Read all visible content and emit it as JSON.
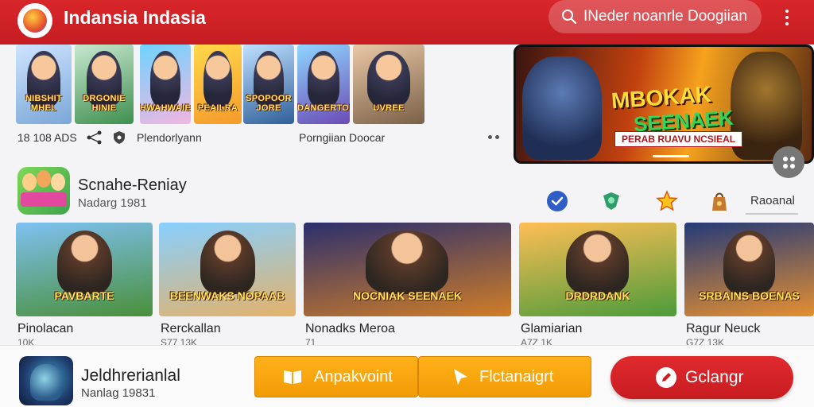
{
  "app": {
    "title": "Indansia Indasia",
    "logo_icon": "mascot-logo-icon"
  },
  "search": {
    "placeholder": "INeder noanrle Doogiian",
    "icon": "search-icon"
  },
  "top_row": {
    "thumbnails": [
      {
        "caption": "NIBSHIT MHEL",
        "colors": [
          "#cfe4ff",
          "#7aa7d8"
        ]
      },
      {
        "caption": "DRGONIE HINIE",
        "colors": [
          "#c8e8d0",
          "#3f8f4f"
        ]
      },
      {
        "caption": "HWAHWAIE",
        "colors": [
          "#6fd3ff",
          "#f2b6e0"
        ]
      },
      {
        "caption": "PEAILRA",
        "colors": [
          "#ffd84a",
          "#f59a2a"
        ]
      },
      {
        "caption": "SPOPOOR JORE",
        "colors": [
          "#bfe0ff",
          "#2f5f9a"
        ]
      },
      {
        "caption": "DANGERTONAK",
        "colors": [
          "#8fd6ff",
          "#6b4bb5"
        ]
      },
      {
        "caption": "UVREE",
        "colors": [
          "#e9c8a6",
          "#7a6048"
        ]
      }
    ],
    "meta_left": "18 108 ADS",
    "meta_mid": "Plendorlyann",
    "meta_right": "Porngiian Doocar",
    "share_icon": "share-icon",
    "shield_icon": "shield-icon",
    "more_icon": "more-dots-icon"
  },
  "hero": {
    "line1": "MBOKAK",
    "line2": "SEENAEK",
    "tag": "PERAB RUAVU NCSIEAL"
  },
  "section": {
    "title": "Scnahe-Reniay",
    "subtitle": "Nadarg 1981",
    "link": "Raoanal",
    "chips": [
      "check-circle-icon",
      "green-character-icon",
      "star-character-icon",
      "bag-character-icon"
    ]
  },
  "cards": [
    {
      "title": "Pinolacan",
      "sub": "10K",
      "caption": "PAVBARTE",
      "colors": [
        "#7fc1f2",
        "#4a8f3a"
      ]
    },
    {
      "title": "Rerckallan",
      "sub": "S77 13K",
      "caption": "BEENWAKS NOPAAB",
      "colors": [
        "#87cfff",
        "#e4b26a"
      ]
    },
    {
      "title": "Nonadks Meroa",
      "sub": "71",
      "caption": "NOCNIAK SEENAEK",
      "colors": [
        "#2b2f6e",
        "#d07d27"
      ]
    },
    {
      "title": "Glamiarian",
      "sub": "A7Z 1K",
      "caption": "DRDRDANK",
      "colors": [
        "#ffbe55",
        "#4c9b3a"
      ]
    },
    {
      "title": "Ragur Neuck",
      "sub": "G7Z 13K",
      "caption": "SRBAINS BOENAS",
      "colors": [
        "#243a78",
        "#e58f31"
      ]
    }
  ],
  "bottom": {
    "title": "Jeldhrerianlal",
    "subtitle": "Nanlag 19831",
    "btn1": "Anpakvoint",
    "btn2": "Flctanaigrt",
    "btn3": "Gclangr"
  }
}
